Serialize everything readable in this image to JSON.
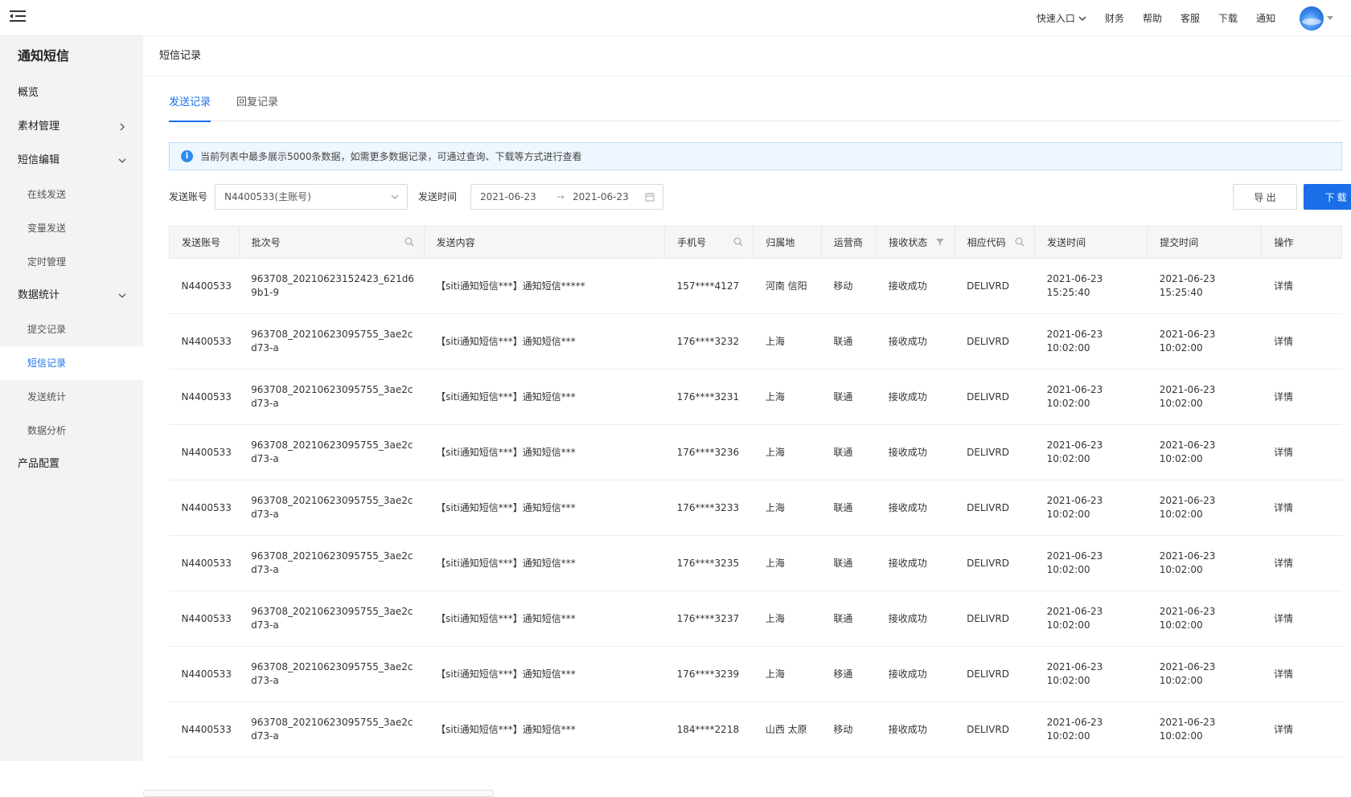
{
  "topbar": {
    "nav": [
      "快速入口",
      "财务",
      "帮助",
      "客服",
      "下载",
      "通知"
    ]
  },
  "sidebar": {
    "title": "通知短信",
    "items": [
      {
        "label": "概览",
        "type": "top"
      },
      {
        "label": "素材管理",
        "type": "top",
        "arrow": "right"
      },
      {
        "label": "短信编辑",
        "type": "top",
        "arrow": "down"
      },
      {
        "label": "在线发送",
        "type": "sub"
      },
      {
        "label": "变量发送",
        "type": "sub"
      },
      {
        "label": "定时管理",
        "type": "sub"
      },
      {
        "label": "数据统计",
        "type": "top",
        "arrow": "down"
      },
      {
        "label": "提交记录",
        "type": "sub"
      },
      {
        "label": "短信记录",
        "type": "sub",
        "active": true
      },
      {
        "label": "发送统计",
        "type": "sub"
      },
      {
        "label": "数据分析",
        "type": "sub"
      },
      {
        "label": "产品配置",
        "type": "top"
      }
    ]
  },
  "page": {
    "title": "短信记录",
    "tabs": [
      {
        "label": "发送记录",
        "active": true
      },
      {
        "label": "回复记录",
        "active": false
      }
    ],
    "notice": "当前列表中最多展示5000条数据，如需更多数据记录，可通过查询、下载等方式进行查看"
  },
  "filters": {
    "account_label": "发送账号",
    "account_value": "N4400533(主账号)",
    "time_label": "发送时间",
    "date_from": "2021-06-23",
    "date_to": "2021-06-23",
    "export_label": "导 出",
    "download_label": "下 载"
  },
  "table": {
    "columns": [
      "发送账号",
      "批次号",
      "发送内容",
      "手机号",
      "归属地",
      "运营商",
      "接收状态",
      "相应代码",
      "发送时间",
      "提交时间",
      "操作"
    ],
    "rows": [
      [
        "N4400533",
        "963708_20210623152423_621d69b1-9",
        "【siti通知短信***】通知短信*****",
        "157****4127",
        "河南 信阳",
        "移动",
        "接收成功",
        "DELIVRD",
        "2021-06-23 15:25:40",
        "2021-06-23 15:25:40",
        "详情"
      ],
      [
        "N4400533",
        "963708_20210623095755_3ae2cd73-a",
        "【siti通知短信***】通知短信***",
        "176****3232",
        "上海",
        "联通",
        "接收成功",
        "DELIVRD",
        "2021-06-23 10:02:00",
        "2021-06-23 10:02:00",
        "详情"
      ],
      [
        "N4400533",
        "963708_20210623095755_3ae2cd73-a",
        "【siti通知短信***】通知短信***",
        "176****3231",
        "上海",
        "联通",
        "接收成功",
        "DELIVRD",
        "2021-06-23 10:02:00",
        "2021-06-23 10:02:00",
        "详情"
      ],
      [
        "N4400533",
        "963708_20210623095755_3ae2cd73-a",
        "【siti通知短信***】通知短信***",
        "176****3236",
        "上海",
        "联通",
        "接收成功",
        "DELIVRD",
        "2021-06-23 10:02:00",
        "2021-06-23 10:02:00",
        "详情"
      ],
      [
        "N4400533",
        "963708_20210623095755_3ae2cd73-a",
        "【siti通知短信***】通知短信***",
        "176****3233",
        "上海",
        "联通",
        "接收成功",
        "DELIVRD",
        "2021-06-23 10:02:00",
        "2021-06-23 10:02:00",
        "详情"
      ],
      [
        "N4400533",
        "963708_20210623095755_3ae2cd73-a",
        "【siti通知短信***】通知短信***",
        "176****3235",
        "上海",
        "联通",
        "接收成功",
        "DELIVRD",
        "2021-06-23 10:02:00",
        "2021-06-23 10:02:00",
        "详情"
      ],
      [
        "N4400533",
        "963708_20210623095755_3ae2cd73-a",
        "【siti通知短信***】通知短信***",
        "176****3237",
        "上海",
        "联通",
        "接收成功",
        "DELIVRD",
        "2021-06-23 10:02:00",
        "2021-06-23 10:02:00",
        "详情"
      ],
      [
        "N4400533",
        "963708_20210623095755_3ae2cd73-a",
        "【siti通知短信***】通知短信***",
        "176****3239",
        "上海",
        "移通",
        "接收成功",
        "DELIVRD",
        "2021-06-23 10:02:00",
        "2021-06-23 10:02:00",
        "详情"
      ],
      [
        "N4400533",
        "963708_20210623095755_3ae2cd73-a",
        "【siti通知短信***】通知短信***",
        "184****2218",
        "山西 太原",
        "移动",
        "接收成功",
        "DELIVRD",
        "2021-06-23 10:02:00",
        "2021-06-23 10:02:00",
        "详情"
      ]
    ]
  },
  "colors": {
    "accent": "#1a6fe8",
    "sidebar_bg": "#f2f3f5",
    "notice_bg": "#eef7ff"
  },
  "icons": {
    "menu": "menu-fold-icon",
    "search": "search-icon",
    "filter": "filter-icon",
    "calendar": "calendar-icon",
    "info": "info-icon"
  }
}
